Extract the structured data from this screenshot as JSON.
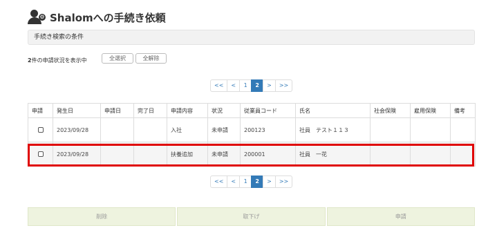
{
  "header": {
    "title": "Shalomへの手続き依頼",
    "icon": "user-gear-icon"
  },
  "condition_bar": {
    "label": "手続き検索の条件"
  },
  "summary": {
    "count": "2",
    "text": "件の申請状況を表示中"
  },
  "selection": {
    "select_all": "全選択",
    "deselect_all": "全解除"
  },
  "pagination": {
    "items": [
      "<<",
      "<",
      "1",
      "2",
      ">",
      ">>"
    ],
    "active": "2"
  },
  "table": {
    "headers": [
      "申請",
      "発生日",
      "申請日",
      "完了日",
      "申請内容",
      "状況",
      "従業員コード",
      "氏名",
      "社会保険",
      "雇用保険",
      "備考"
    ],
    "rows": [
      {
        "occurred": "2023/09/28",
        "applied": "",
        "completed": "",
        "content": "入社",
        "status": "未申請",
        "code": "200123",
        "name": "社員　テスト１１３",
        "social": "",
        "employment": "",
        "note": ""
      },
      {
        "occurred": "2023/09/28",
        "applied": "",
        "completed": "",
        "content": "扶養追加",
        "status": "未申請",
        "code": "200001",
        "name": "社員　一花",
        "social": "",
        "employment": "",
        "note": ""
      }
    ]
  },
  "actions": {
    "delete": "削除",
    "withdraw": "取下げ",
    "apply": "申請"
  },
  "colors": {
    "highlight": "#e00000",
    "pager_active": "#337ab7",
    "action_bg": "#eef3df"
  }
}
